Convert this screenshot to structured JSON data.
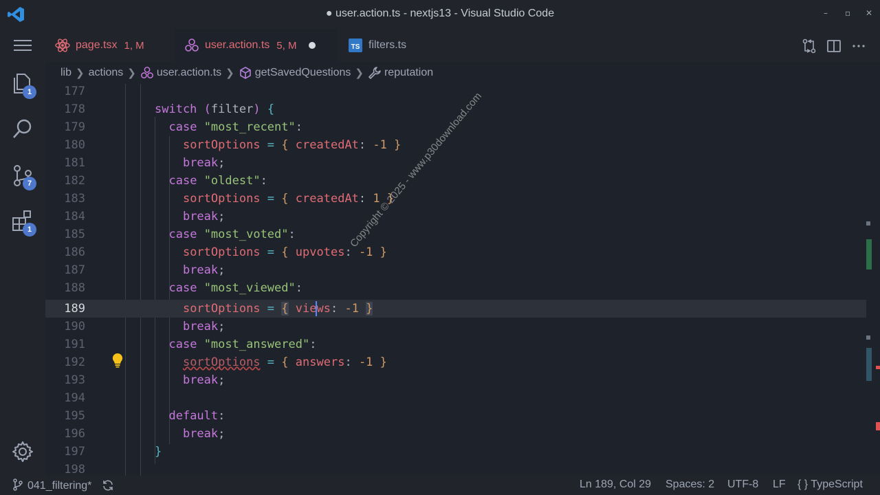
{
  "window": {
    "title": "● user.action.ts - nextjs13 - Visual Studio Code",
    "minimize": "–",
    "maximize": "▫",
    "close": "✕"
  },
  "activity": {
    "explorer_badge": "1",
    "scm_badge": "7",
    "extensions_badge": "1"
  },
  "tabs": [
    {
      "label": "page.tsx",
      "status": "1, M"
    },
    {
      "label": "user.action.ts",
      "status": "5, M"
    },
    {
      "label": "filters.ts",
      "status": ""
    }
  ],
  "breadcrumb": {
    "items": [
      "lib",
      "actions",
      "user.action.ts",
      "getSavedQuestions",
      "reputation"
    ]
  },
  "editor": {
    "line_numbers": [
      "177",
      "178",
      "179",
      "180",
      "181",
      "182",
      "183",
      "184",
      "185",
      "186",
      "187",
      "188",
      "189",
      "190",
      "191",
      "192",
      "193",
      "194",
      "195",
      "196",
      "197",
      "198"
    ],
    "current_line": "189"
  },
  "watermark": "Copyright © 2025 - www.p30download.com",
  "statusbar": {
    "branch": "041_filtering*",
    "position": "Ln 189, Col 29",
    "spaces": "Spaces: 2",
    "encoding": "UTF-8",
    "eol": "LF",
    "language_icon": "{ }",
    "language": "TypeScript"
  },
  "colors": {
    "accent": "#4d78cc",
    "error": "#e06c75",
    "keyword": "#c678dd",
    "string": "#98c379",
    "number": "#d19a66"
  }
}
